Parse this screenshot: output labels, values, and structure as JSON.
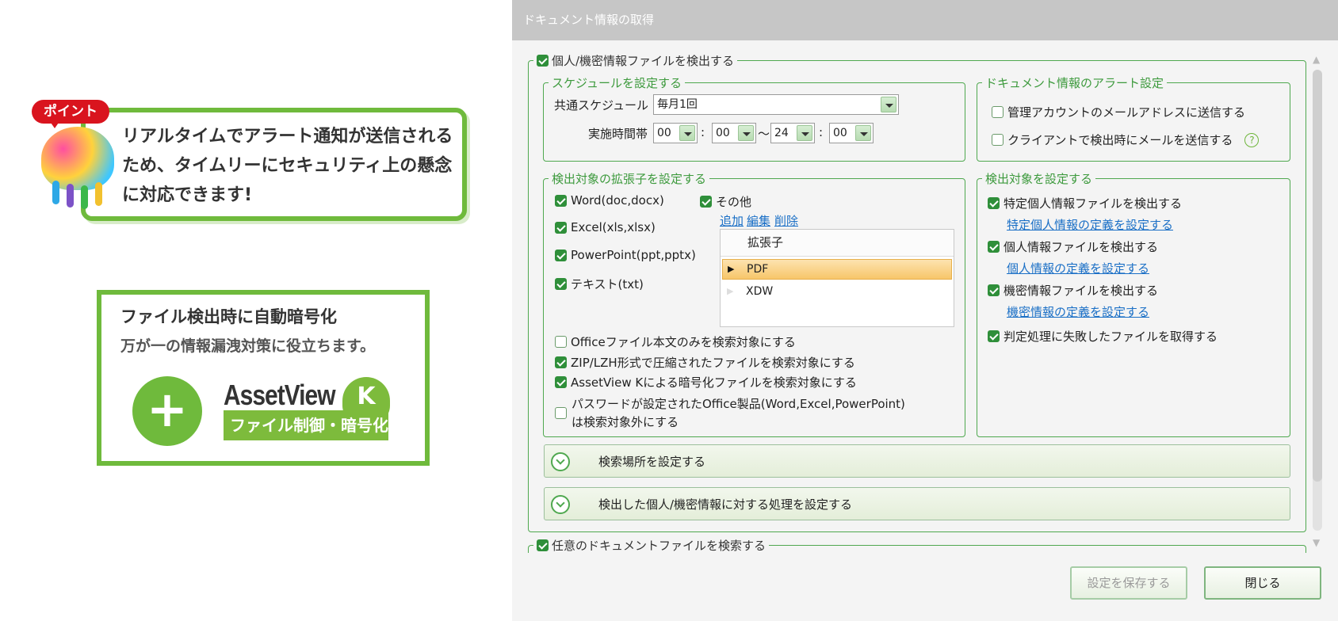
{
  "promo": {
    "point_badge": "ポイント",
    "point_text": "リアルタイムでアラート通知が送信されるため、タイムリーにセキュリティ上の懸念に対応できます!",
    "encrypt_title": "ファイル検出時に自動暗号化",
    "encrypt_sub": "万が一の情報漏洩対策に役立ちます。",
    "plus": "+",
    "logo_word": "AssetView",
    "logo_letter": "K",
    "logo_band": "ファイル制御・暗号化"
  },
  "dialog": {
    "title": "ドキュメント情報の取得",
    "main_group": {
      "label": "個人/機密情報ファイルを検出する",
      "checked": true
    },
    "schedule": {
      "legend": "スケジュールを設定する",
      "common_label": "共通スケジュール",
      "common_value": "毎月1回",
      "time_label": "実施時間帯",
      "start_hour": "00",
      "start_min": "00",
      "end_hour": "24",
      "end_min": "00",
      "colon": ":",
      "tilde": "〜"
    },
    "alert": {
      "legend": "ドキュメント情報のアラート設定",
      "opt1": "管理アカウントのメールアドレスに送信する",
      "opt2": "クライアントで検出時にメールを送信する",
      "help": "?"
    },
    "extensions": {
      "legend": "検出対象の拡張子を設定する",
      "word": "Word(doc,docx)",
      "excel": "Excel(xls,xlsx)",
      "ppt": "PowerPoint(ppt,pptx)",
      "text": "テキスト(txt)",
      "other": "その他",
      "add": "追加",
      "edit": "編集",
      "delete": "削除",
      "grid_header": "拡張子",
      "grid_rows": [
        "PDF",
        "XDW"
      ],
      "office_body_only": "Officeファイル本文のみを検索対象にする",
      "zip_lzh": "ZIP/LZH形式で圧縮されたファイルを検索対象にする",
      "assetview_k": "AssetView Kによる暗号化ファイルを検索対象にする",
      "password_line1": "パスワードが設定されたOffice製品(Word,Excel,PowerPoint)",
      "password_line2": "は検索対象外にする"
    },
    "targets": {
      "legend": "検出対象を設定する",
      "t1": "特定個人情報ファイルを検出する",
      "t1_link": "特定個人情報の定義を設定する",
      "t2": "個人情報ファイルを検出する",
      "t2_link": "個人情報の定義を設定する",
      "t3": "機密情報ファイルを検出する",
      "t3_link": "機密情報の定義を設定する",
      "t4": "判定処理に失敗したファイルを取得する"
    },
    "expander1": "検索場所を設定する",
    "expander2": "検出した個人/機密情報に対する処理を設定する",
    "second_group": "任意のドキュメントファイルを検索する",
    "save_button": "設定を保存する",
    "close_button": "閉じる"
  }
}
